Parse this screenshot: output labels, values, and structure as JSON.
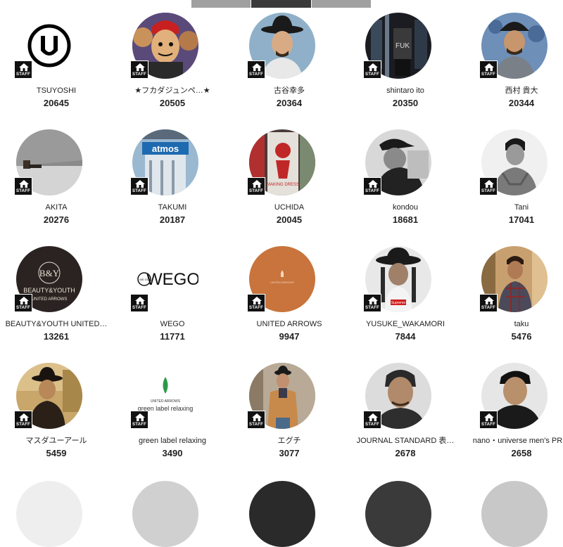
{
  "tabs": [
    "",
    "",
    ""
  ],
  "staff_badge": "STAFF",
  "users": [
    {
      "name": "TSUYOSHI",
      "count": "20645",
      "avatar": "v-logo-icon"
    },
    {
      "name": "★フカダジュンペ…★",
      "count": "20505",
      "avatar": "cartoon-portrait"
    },
    {
      "name": "古谷幸多",
      "count": "20364",
      "avatar": "hat-portrait"
    },
    {
      "name": "shintaro ito",
      "count": "20350",
      "avatar": "night-street"
    },
    {
      "name": "西村 貴大",
      "count": "20344",
      "avatar": "cap-portrait"
    },
    {
      "name": "AKITA",
      "count": "20276",
      "avatar": "seated-concrete"
    },
    {
      "name": "TAKUMI",
      "count": "20187",
      "avatar": "atmos-storefront"
    },
    {
      "name": "UCHIDA",
      "count": "20045",
      "avatar": "red-tshirt"
    },
    {
      "name": "kondou",
      "count": "18681",
      "avatar": "monochrome-cap"
    },
    {
      "name": "Tani",
      "count": "17041",
      "avatar": "monochrome-sweater"
    },
    {
      "name": "BEAUTY&YOUTH UNITED…",
      "count": "13261",
      "avatar": "beauty-youth-logo"
    },
    {
      "name": "WEGO",
      "count": "11771",
      "avatar": "wego-logo"
    },
    {
      "name": "UNITED ARROWS",
      "count": "9947",
      "avatar": "united-arrows-logo"
    },
    {
      "name": "YUSUKE_WAKAMORI",
      "count": "7844",
      "avatar": "hat-supreme"
    },
    {
      "name": "taku",
      "count": "5476",
      "avatar": "plaid-shirt"
    },
    {
      "name": "マスダユーアール",
      "count": "5459",
      "avatar": "vintage-hat"
    },
    {
      "name": "green label relaxing",
      "count": "3490",
      "avatar": "green-label-logo"
    },
    {
      "name": "エグチ",
      "count": "3077",
      "avatar": "camel-coat"
    },
    {
      "name": "JOURNAL STANDARD 表…",
      "count": "2678",
      "avatar": "tilted-portrait"
    },
    {
      "name": "nano・universe men's PR…",
      "count": "2658",
      "avatar": "dark-portrait"
    }
  ],
  "logos": {
    "beauty_youth_main": "BEAUTY&YOUTH",
    "beauty_youth_sub": "UNITED ARROWS",
    "wego": "WEGO",
    "wego_seal": "WE GO",
    "united_arrows": "UNITED ARROWS",
    "green_label_top": "UNITED ARROWS",
    "green_label_bottom": "green label relaxing",
    "atmos": "atmos",
    "supreme": "Supreme",
    "tee_text": "FUK",
    "tee_small": "MAKING DRESS"
  }
}
